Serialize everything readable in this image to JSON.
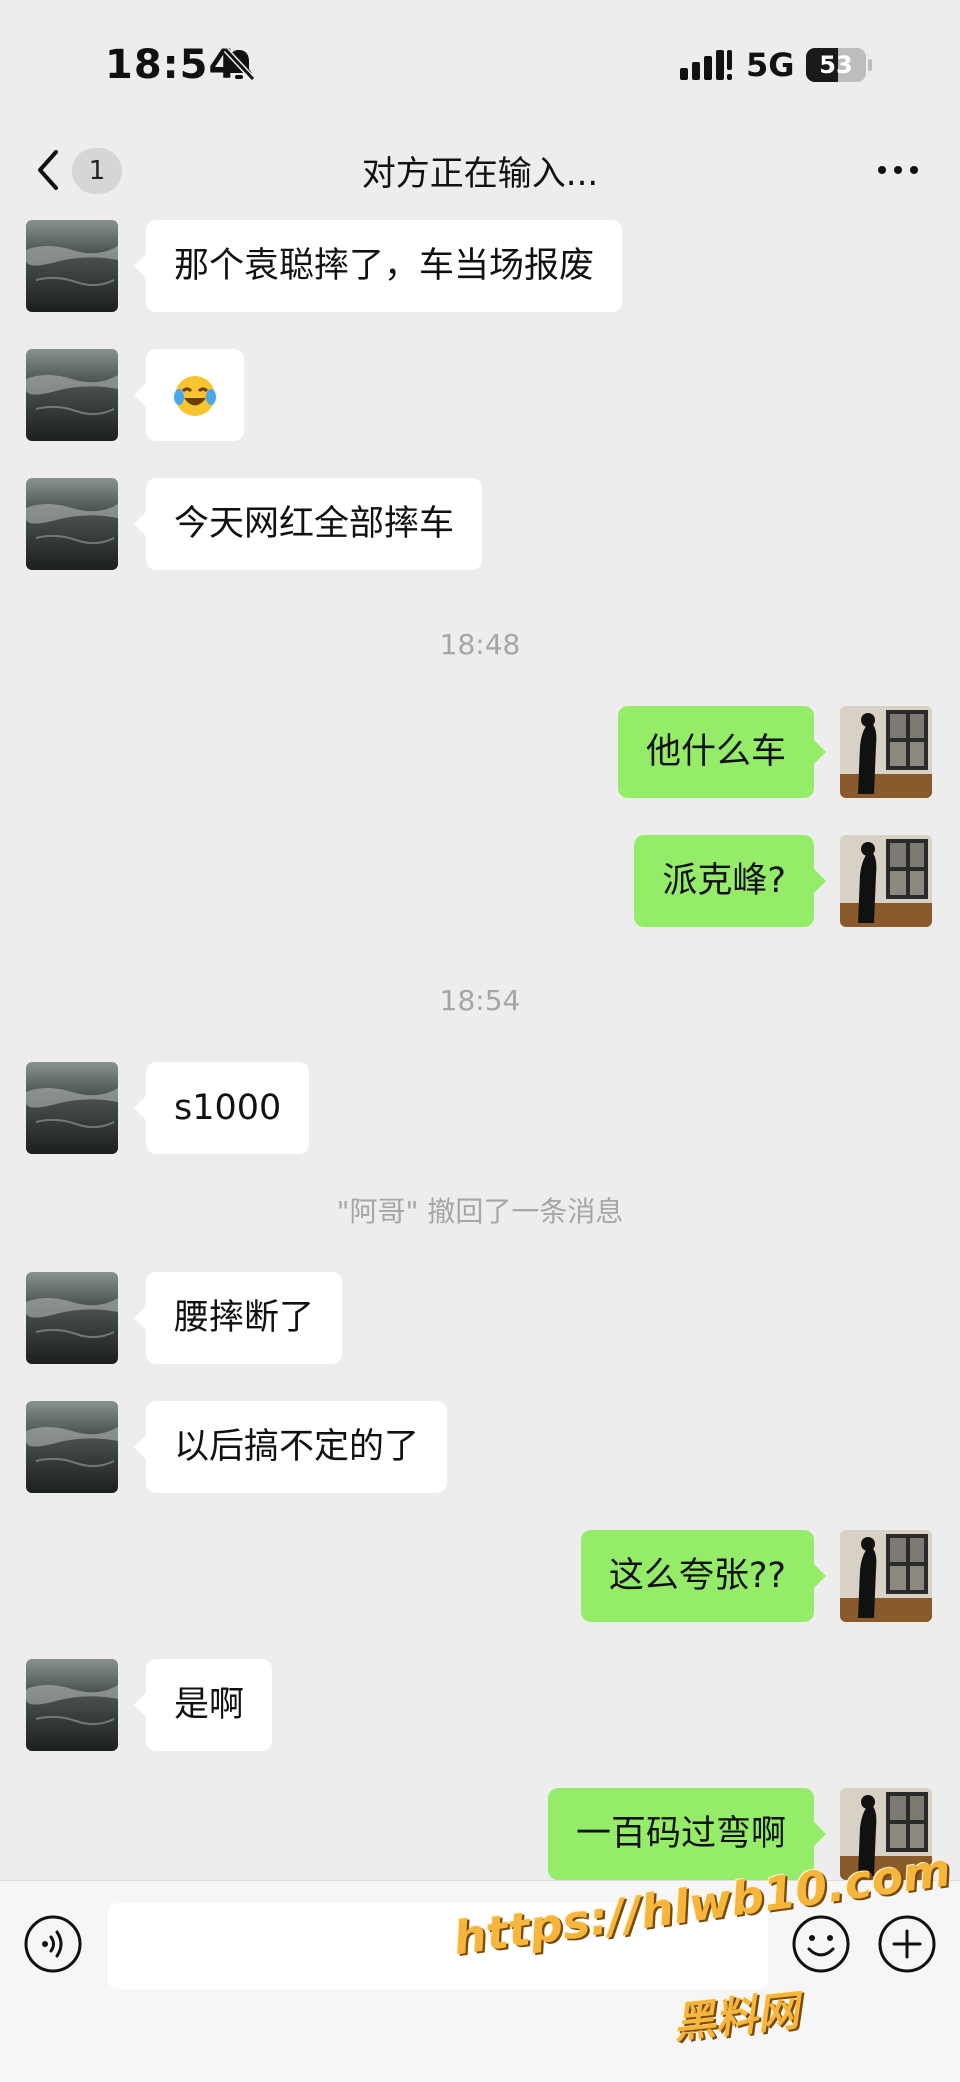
{
  "status_bar": {
    "time": "18:54",
    "network": "5G",
    "battery": "53",
    "battery_level": 0.53
  },
  "nav": {
    "unread_count": "1",
    "title": "对方正在输入..."
  },
  "chat": {
    "messages": [
      {
        "side": "left",
        "type": "text",
        "text": "那个袁聪摔了，车当场报废"
      },
      {
        "side": "left",
        "type": "emoji",
        "emoji_name": "laughing-crying-emoji",
        "text": ""
      },
      {
        "side": "left",
        "type": "text",
        "text": "今天网红全部摔车"
      },
      {
        "type": "timestamp",
        "text": "18:48"
      },
      {
        "side": "right",
        "type": "text",
        "text": "他什么车"
      },
      {
        "side": "right",
        "type": "text",
        "text": "派克峰?"
      },
      {
        "type": "timestamp",
        "text": "18:54"
      },
      {
        "side": "left",
        "type": "text",
        "text": "s1000"
      },
      {
        "type": "system",
        "text": "\"阿哥\" 撤回了一条消息"
      },
      {
        "side": "left",
        "type": "text",
        "text": "腰摔断了"
      },
      {
        "side": "left",
        "type": "text",
        "text": "以后搞不定的了"
      },
      {
        "side": "right",
        "type": "text",
        "text": "这么夸张??"
      },
      {
        "side": "left",
        "type": "text",
        "text": "是啊"
      },
      {
        "side": "right",
        "type": "text",
        "text": "一百码过弯啊"
      }
    ]
  },
  "input_bar": {
    "placeholder": ""
  },
  "watermark": {
    "url": "https://hlwb10.com",
    "name": "黑料网"
  },
  "colors": {
    "background": "#ededed",
    "bubble_self": "#95ec69",
    "bubble_other": "#ffffff",
    "watermark": "#f6b53c"
  }
}
